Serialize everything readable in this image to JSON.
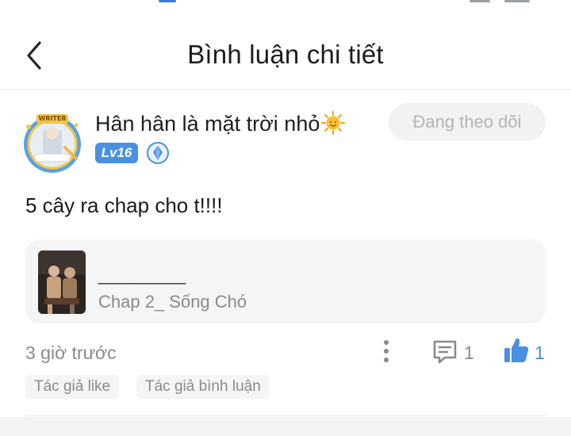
{
  "header": {
    "title": "Bình luận chi tiết",
    "back_icon": "chevron-left-icon"
  },
  "author": {
    "name": "Hân hân là mặt trời nhỏ",
    "name_emoji_icon": "sun-emoji-icon",
    "level": "Lv16",
    "avatar_badge": "WRITER",
    "follow_label": "Đang theo dõi"
  },
  "comment": {
    "text": "5 cây ra chap cho t!!!!"
  },
  "chapter_card": {
    "name": "_________",
    "subtitle": "Chap 2_ Sống Chó"
  },
  "meta": {
    "time": "3 giờ trước",
    "reply_count": "1",
    "like_count": "1"
  },
  "tags": [
    "Tác giả like",
    "Tác giả bình luận"
  ],
  "colors": {
    "accent": "#4a90e2",
    "muted": "#8a8a8a",
    "card_bg": "#f5f5f5"
  }
}
